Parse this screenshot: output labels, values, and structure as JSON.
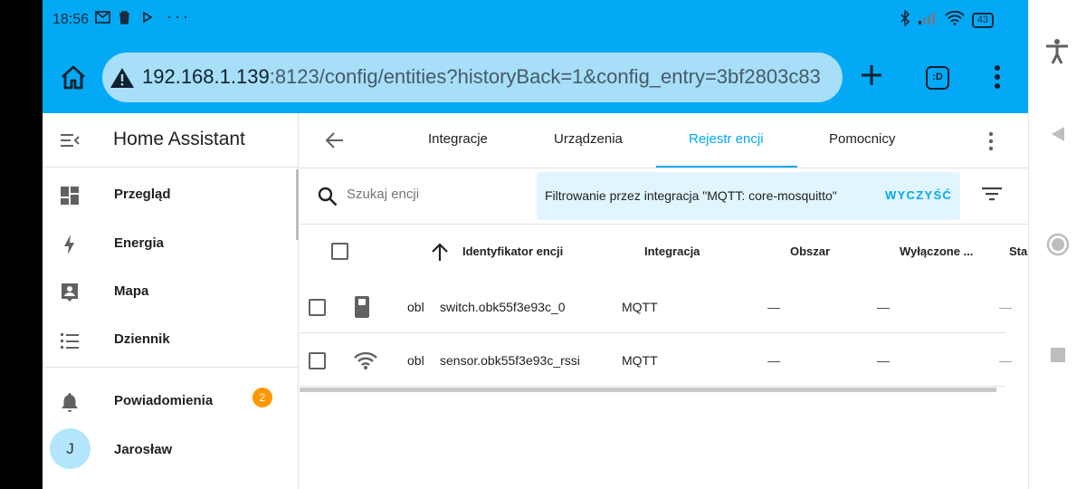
{
  "status_bar": {
    "time": "18:56",
    "notification_icons": [
      "gmail-icon",
      "trash-icon",
      "play-icon",
      "more-dots-icon"
    ],
    "battery": "43"
  },
  "browser": {
    "url_host": "192.168.1.139",
    "url_rest": ":8123/config/entities?historyBack=1&config_entry=3bf2803c83",
    "tab_count": ":D"
  },
  "sidebar": {
    "title": "Home Assistant",
    "items": [
      {
        "label": "Przegląd",
        "icon": "dashboard-icon"
      },
      {
        "label": "Energia",
        "icon": "lightning-icon"
      },
      {
        "label": "Mapa",
        "icon": "map-person-icon"
      },
      {
        "label": "Dziennik",
        "icon": "list-icon"
      }
    ],
    "notifications": {
      "label": "Powiadomienia",
      "count": "2"
    },
    "user": {
      "label": "Jarosław",
      "initial": "J"
    }
  },
  "tabs": [
    {
      "label": "Integracje"
    },
    {
      "label": "Urządzenia"
    },
    {
      "label": "Rejestr encji",
      "active": true
    },
    {
      "label": "Pomocnicy"
    }
  ],
  "search": {
    "placeholder": "Szukaj encji"
  },
  "filter": {
    "text": "Filtrowanie przez integracja \"MQTT: core-mosquitto\"",
    "clear_label": "WYCZYŚĆ"
  },
  "table": {
    "headers": {
      "entity_id": "Identyfikator encji",
      "integration": "Integracja",
      "area": "Obszar",
      "disabled": "Wyłączone ...",
      "status": "Sta"
    },
    "rows": [
      {
        "icon": "switch-icon",
        "name": "obl",
        "entity_id": "switch.obk55f3e93c_0",
        "integration": "MQTT",
        "area": "—",
        "disabled": "—",
        "status": "—"
      },
      {
        "icon": "wifi-icon",
        "name": "obl",
        "entity_id": "sensor.obk55f3e93c_rssi",
        "integration": "MQTT",
        "area": "—",
        "disabled": "—",
        "status": "—"
      }
    ]
  },
  "colors": {
    "primary": "#03a9f4",
    "badge": "#ff9800",
    "filter_bg": "#e1f5fe"
  }
}
